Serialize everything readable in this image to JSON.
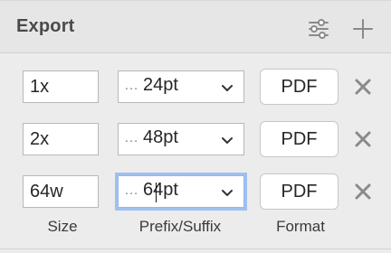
{
  "panel": {
    "title": "Export",
    "header_icons": [
      "settings-sliders-icon",
      "plus-icon"
    ]
  },
  "rows": [
    {
      "size": "1x",
      "prefix_indicator": "…",
      "suffix": "24pt",
      "format": "PDF",
      "focused": false
    },
    {
      "size": "2x",
      "prefix_indicator": "…",
      "suffix": "48pt",
      "format": "PDF",
      "focused": false
    },
    {
      "size": "64w",
      "prefix_indicator": "…",
      "suffix": "64pt",
      "format": "PDF",
      "focused": true
    }
  ],
  "labels": {
    "size": "Size",
    "prefix_suffix": "Prefix/Suffix",
    "format": "Format"
  },
  "colors": {
    "focus_ring": "#9fc0f0",
    "panel_bg": "#ececec",
    "header_bg": "#e6e6e6"
  }
}
